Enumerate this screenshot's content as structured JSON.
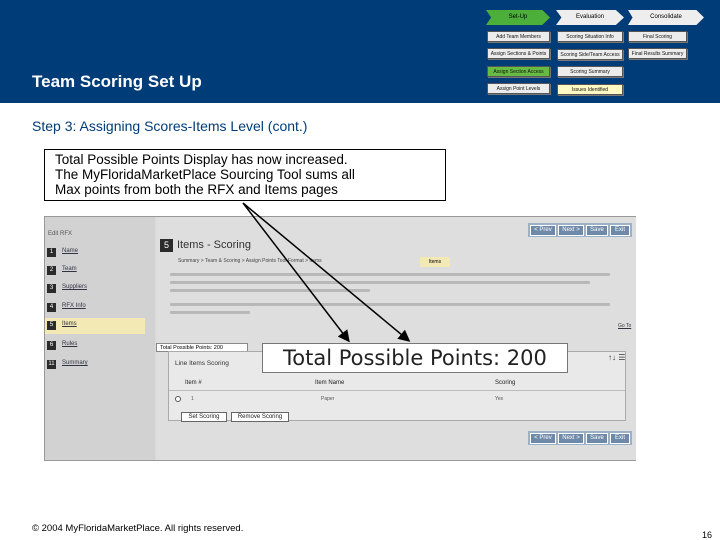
{
  "header": {
    "title": "Team Scoring Set Up",
    "flow_tabs": [
      "Set-Up",
      "Evaluation",
      "Consolidate"
    ],
    "flow_boxes": {
      "col1": [
        "Add Team Members",
        "Assign Sections & Points",
        "Assign Section Access",
        "Assign Point Levels"
      ],
      "col2": [
        "Scoring Situation Info",
        "Scoring Side/Team Access",
        "Scoring Summary",
        "Issues Identified"
      ],
      "col3": [
        "Final Scoring",
        "Final Results Summary"
      ]
    }
  },
  "step_title": "Step 3: Assigning Scores-Items Level (cont.)",
  "callout": {
    "lines": [
      "Total Possible Points Display has now increased.",
      "The MyFloridaMarketPlace Sourcing Tool sums all",
      "Max points from both the RFX and Items pages"
    ]
  },
  "screenshot": {
    "sidebar_header": "Edit RFX",
    "sidebar_items": [
      {
        "num": "1",
        "label": "Name"
      },
      {
        "num": "2",
        "label": "Team"
      },
      {
        "num": "3",
        "label": "Suppliers"
      },
      {
        "num": "4",
        "label": "RFX Info"
      },
      {
        "num": "5",
        "label": "Items"
      },
      {
        "num": "6",
        "label": "Rules"
      },
      {
        "num": "11",
        "label": "Summary"
      }
    ],
    "active_item": "Items",
    "top_buttons": [
      "< Prev",
      "Next >",
      "Save",
      "Exit"
    ],
    "bottom_buttons": [
      "< Prev",
      "Next >",
      "Save",
      "Exit"
    ],
    "section_num": "5",
    "section_title": "Items - Scoring",
    "breadcrumb": "Summary > Team & Scoring > Assign Points Tool Format > Items",
    "crumb_highlight": "Items",
    "help_link": "Go To",
    "total_small": "Total Possible Points: 200",
    "table": {
      "title": "Line Items Scoring",
      "headers": [
        "Item #",
        "Item Name",
        "Scoring"
      ],
      "row": [
        "1",
        "Paper",
        "Yes"
      ],
      "buttons": [
        "Set Scoring",
        "Remove Scoring"
      ]
    },
    "table_icons": "↑↓ ☰"
  },
  "zoom_total": "Total Possible Points: 200",
  "footer": {
    "copyright": "© 2004 MyFloridaMarketPlace. All rights reserved.",
    "page": "16"
  }
}
